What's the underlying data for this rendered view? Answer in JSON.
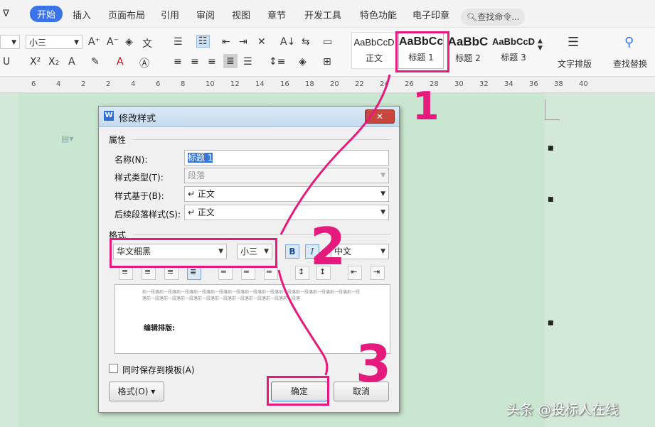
{
  "menu": {
    "tabs": [
      "开始",
      "插入",
      "页面布局",
      "引用",
      "审阅",
      "视图",
      "章节",
      "开发工具",
      "特色功能",
      "电子印章"
    ],
    "search_placeholder": "查找命令..."
  },
  "toolbar": {
    "font_size": "小三",
    "styles": [
      {
        "sample": "AaBbCcD",
        "label": "正文"
      },
      {
        "sample": "AaBbCc",
        "label": "标题 1"
      },
      {
        "sample": "AaBbC",
        "label": "标题 2"
      },
      {
        "sample": "AaBbCcD",
        "label": "标题 3"
      }
    ],
    "text_layout_label": "文字排版",
    "find_replace_label": "查找替换"
  },
  "ruler": {
    "numbers": [
      "6",
      "4",
      "2",
      "2",
      "4",
      "6",
      "8",
      "10",
      "12",
      "14",
      "16",
      "18",
      "20",
      "22",
      "24",
      "26",
      "28",
      "30",
      "32",
      "34",
      "36",
      "38",
      "40"
    ]
  },
  "dialog": {
    "title": "修改样式",
    "properties_heading": "属性",
    "name_label": "名称(N):",
    "name_value": "标题 1",
    "style_type_label": "样式类型(T):",
    "style_type_value": "段落",
    "based_on_label": "样式基于(B):",
    "based_on_value": "↵ 正文",
    "next_style_label": "后续段落样式(S):",
    "next_style_value": "↵ 正文",
    "format_heading": "格式",
    "font_name": "华文细黑",
    "font_size": "小三",
    "bold_label": "B",
    "italic_label": "I",
    "script": "中文",
    "preview_prev_text": "前一段落前一段落前一段落前一段落前一段落前一段落前一段落前一段落前一段落前一段落前一段落前一段落前一段落前一段落前一段落前一段落前一段落前一段落前一段落前一段落前一段落前一段落",
    "preview_sample": "编辑排版:",
    "save_to_template_label": "同时保存到模板(A)",
    "format_button": "格式(O)",
    "ok_button": "确定",
    "cancel_button": "取消"
  },
  "annotations": {
    "marks": [
      "1",
      "2",
      "3"
    ],
    "color": "#e6197d"
  },
  "watermark": "头条 @投标人在线"
}
